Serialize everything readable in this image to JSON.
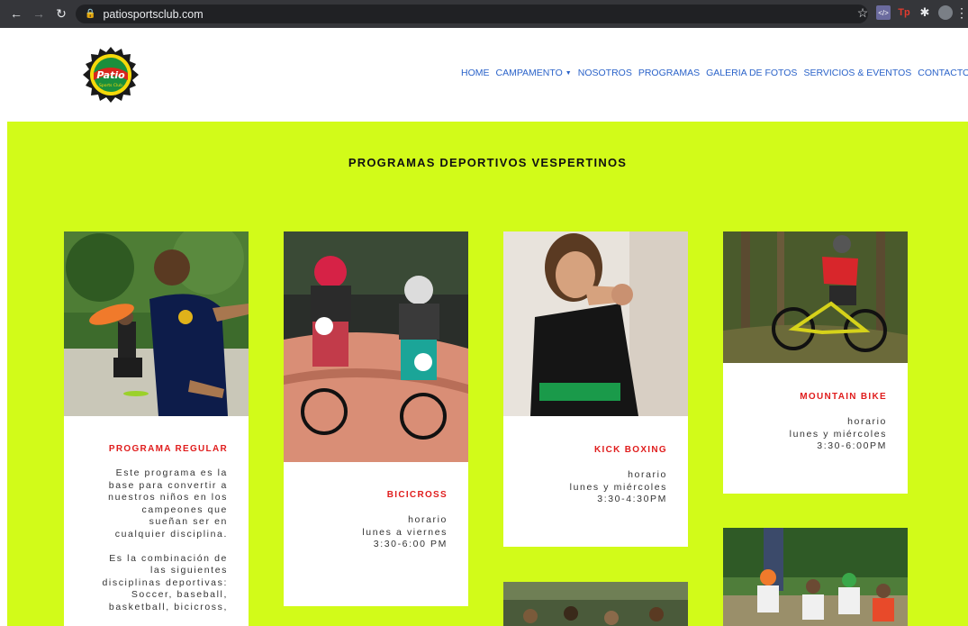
{
  "browser": {
    "url": "patiosportsclub.com",
    "icons": [
      "back-icon",
      "forward-icon",
      "reload-icon",
      "lock-icon",
      "star-icon",
      "extension-icon",
      "tp-extension-icon",
      "puzzle-icon",
      "profile-avatar",
      "menu-icon"
    ]
  },
  "header": {
    "logo_text": "Patio",
    "logo_subtext": "Sports Club",
    "nav": [
      {
        "label": "HOME"
      },
      {
        "label": "CAMPAMENTO"
      },
      {
        "label": "NOSOTROS"
      },
      {
        "label": "PROGRAMAS"
      },
      {
        "label": "GALERIA DE FOTOS"
      },
      {
        "label": "SERVICIOS & EVENTOS"
      },
      {
        "label": "CONTACTO"
      }
    ]
  },
  "section": {
    "title": "PROGRAMAS DEPORTIVOS VESPERTINOS",
    "background": "#d2fb19"
  },
  "cards": {
    "regular": {
      "title": "PROGRAMA REGULAR",
      "lines": [
        "Este programa es la",
        "base para convertir a",
        "nuestros niños en los",
        "campeones que",
        "sueñan ser en",
        "cualquier disciplina.",
        "",
        "Es la combinación de",
        "las siguientes",
        "disciplinas deportivas:",
        "Soccer, baseball,",
        "basketball, bicicross,"
      ]
    },
    "bicicross": {
      "title": "BICICROSS",
      "lines": [
        "horario",
        "lunes a viernes",
        "3:30-6:00 PM"
      ]
    },
    "kickboxing": {
      "title": "KICK BOXING",
      "lines": [
        "horario",
        "lunes y miércoles",
        "3:30-4:30PM"
      ]
    },
    "mountainbike": {
      "title": "MOUNTAIN BIKE",
      "lines": [
        "horario",
        "lunes y miércoles",
        "3:30-6:00PM"
      ]
    }
  },
  "colors": {
    "accent_red": "#e01d1d",
    "nav_blue": "#2b63c9",
    "lime": "#d2fb19"
  }
}
